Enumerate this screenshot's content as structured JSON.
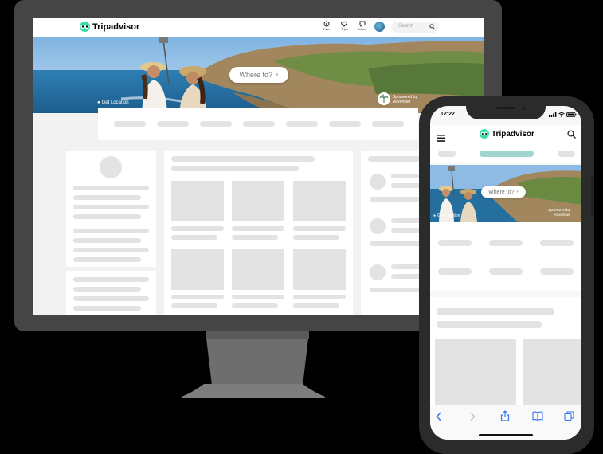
{
  "desktop": {
    "brand": "Tripadvisor",
    "nav": [
      {
        "icon": "plan-icon",
        "label": "Plan"
      },
      {
        "icon": "heart-icon",
        "label": "Trips"
      },
      {
        "icon": "message-icon",
        "label": "Inbox"
      }
    ],
    "search_placeholder": "Search",
    "hero_search": "Where to?",
    "location_tag": "Get Location",
    "sponsored_line1": "Sponsored by",
    "sponsored_line2": "Advertiser"
  },
  "mobile": {
    "status_time": "12:22",
    "brand": "Tripadvisor",
    "hero_search": "Where to?",
    "location_tag": "Get Location",
    "sponsored_line1": "Sponsored by",
    "sponsored_line2": "Advertiser"
  },
  "colors": {
    "background": "#000000",
    "device_frame": "#454545",
    "brand_green": "#34e0a1",
    "skeleton": "#e3e3e3",
    "active_tab": "#9fd6cf",
    "ios_blue": "#3478f6"
  },
  "icons": [
    "menu-icon",
    "search-icon",
    "back-icon",
    "forward-icon",
    "share-icon",
    "bookmarks-icon",
    "tabs-icon",
    "pin-icon"
  ]
}
